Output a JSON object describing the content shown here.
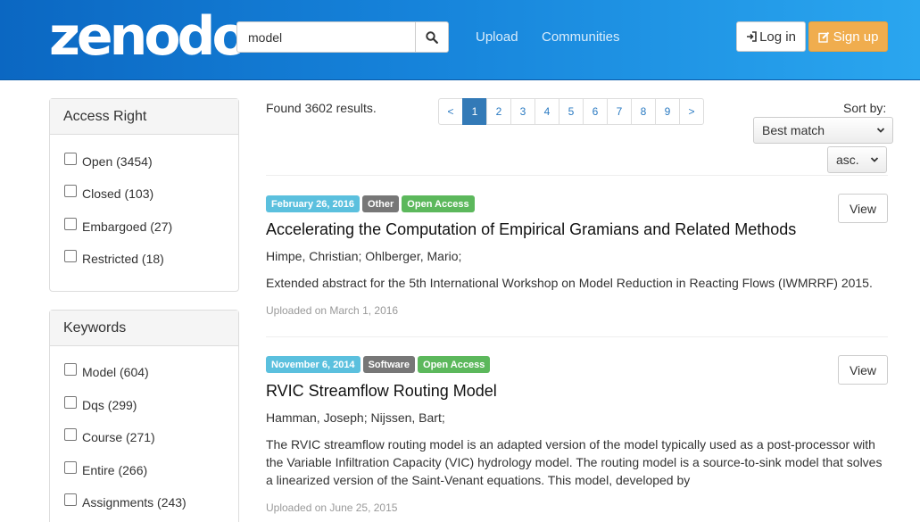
{
  "header": {
    "logo": "zenodo",
    "search_value": "model",
    "nav": [
      "Upload",
      "Communities"
    ],
    "login_label": "Log in",
    "signup_label": "Sign up"
  },
  "facets": [
    {
      "heading": "Access Right",
      "items": [
        "Open (3454)",
        "Closed (103)",
        "Embargoed (27)",
        "Restricted (18)"
      ]
    },
    {
      "heading": "Keywords",
      "items": [
        "Model (604)",
        "Dqs (299)",
        "Course (271)",
        "Entire (266)",
        "Assignments (243)"
      ]
    }
  ],
  "results_summary": "Found 3602 results.",
  "pagination": [
    "<",
    "1",
    "2",
    "3",
    "4",
    "5",
    "6",
    "7",
    "8",
    "9",
    ">"
  ],
  "sort": {
    "label": "Sort by:",
    "selected": "Best match",
    "order": "asc."
  },
  "results": [
    {
      "date": "February 26, 2016",
      "type": "Other",
      "access": "Open Access",
      "title": "Accelerating the Computation of Empirical Gramians and Related Methods",
      "authors": "Himpe, Christian; Ohlberger, Mario;",
      "description": "Extended abstract for the 5th International Workshop on Model Reduction in Reacting Flows (IWMRRF) 2015.",
      "uploaded": "Uploaded on March 1, 2016",
      "view_label": "View"
    },
    {
      "date": "November 6, 2014",
      "type": "Software",
      "access": "Open Access",
      "title": "RVIC Streamflow Routing Model",
      "authors": "Hamman, Joseph; Nijssen, Bart;",
      "description": "The RVIC streamflow routing model is an adapted version of the model typically used as a post-processor with the Variable Infiltration Capacity (VIC) hydrology model. The routing model is a source-to-sink model that solves a linearized version of the Saint-Venant equations. This model, developed by",
      "uploaded": "Uploaded on June 25, 2015",
      "view_label": "View"
    }
  ],
  "colors": {
    "header_start": "#0b67c2",
    "header_end": "#2aa6ef",
    "badge_date": "#5bc0de",
    "badge_type": "#777777",
    "badge_access": "#5cb85c",
    "signup": "#f0ad4e",
    "page_active": "#337ab7"
  }
}
